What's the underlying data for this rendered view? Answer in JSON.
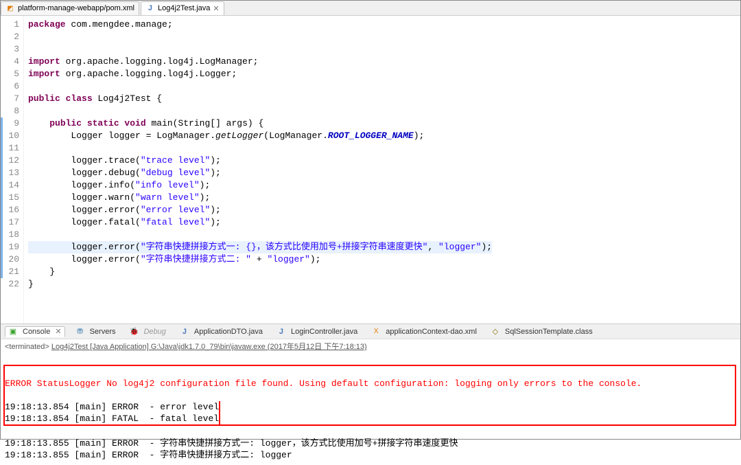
{
  "topTabs": {
    "inactive": "platform-manage-webapp/pom.xml",
    "active": "Log4j2Test.java"
  },
  "gutterLines": [
    "1",
    "2",
    "3",
    "4",
    "5",
    "6",
    "7",
    "8",
    "9",
    "10",
    "11",
    "12",
    "13",
    "14",
    "15",
    "16",
    "17",
    "18",
    "19",
    "20",
    "21",
    "22"
  ],
  "modifiedLines": [
    9,
    10,
    11,
    12,
    13,
    14,
    15,
    16,
    17,
    18,
    19,
    20,
    21
  ],
  "highlightedLine": 19,
  "code": {
    "l1": {
      "tokens": [
        {
          "t": "package ",
          "c": "kw"
        },
        {
          "t": "com.mengdee.manage;",
          "c": ""
        }
      ]
    },
    "l2": {
      "tokens": []
    },
    "l3": {
      "tokens": []
    },
    "l4": {
      "tokens": [
        {
          "t": "import ",
          "c": "kw"
        },
        {
          "t": "org.apache.logging.log4j.LogManager;",
          "c": ""
        }
      ]
    },
    "l5": {
      "tokens": [
        {
          "t": "import ",
          "c": "kw"
        },
        {
          "t": "org.apache.logging.log4j.Logger;",
          "c": ""
        }
      ]
    },
    "l6": {
      "tokens": []
    },
    "l7": {
      "tokens": [
        {
          "t": "public class ",
          "c": "kw"
        },
        {
          "t": "Log4j2Test {",
          "c": ""
        }
      ]
    },
    "l8": {
      "tokens": []
    },
    "l9": {
      "tokens": [
        {
          "t": "    ",
          "c": ""
        },
        {
          "t": "public static void ",
          "c": "kw"
        },
        {
          "t": "main(String[] args) {",
          "c": ""
        }
      ]
    },
    "l10": {
      "tokens": [
        {
          "t": "        Logger logger = LogManager.",
          "c": ""
        },
        {
          "t": "getLogger",
          "c": "it"
        },
        {
          "t": "(LogManager.",
          "c": ""
        },
        {
          "t": "ROOT_LOGGER_NAME",
          "c": "str it kw",
          "style": "color:#0000c0;font-style:italic;font-weight:bold"
        },
        {
          "t": ");",
          "c": ""
        }
      ]
    },
    "l11": {
      "tokens": []
    },
    "l12": {
      "tokens": [
        {
          "t": "        logger.trace(",
          "c": ""
        },
        {
          "t": "\"trace level\"",
          "c": "str"
        },
        {
          "t": ");",
          "c": ""
        }
      ]
    },
    "l13": {
      "tokens": [
        {
          "t": "        logger.debug(",
          "c": ""
        },
        {
          "t": "\"debug level\"",
          "c": "str"
        },
        {
          "t": ");",
          "c": ""
        }
      ]
    },
    "l14": {
      "tokens": [
        {
          "t": "        logger.info(",
          "c": ""
        },
        {
          "t": "\"info level\"",
          "c": "str"
        },
        {
          "t": ");",
          "c": ""
        }
      ]
    },
    "l15": {
      "tokens": [
        {
          "t": "        logger.warn(",
          "c": ""
        },
        {
          "t": "\"warn level\"",
          "c": "str"
        },
        {
          "t": ");",
          "c": ""
        }
      ]
    },
    "l16": {
      "tokens": [
        {
          "t": "        logger.error(",
          "c": ""
        },
        {
          "t": "\"error level\"",
          "c": "str"
        },
        {
          "t": ");",
          "c": ""
        }
      ]
    },
    "l17": {
      "tokens": [
        {
          "t": "        logger.fatal(",
          "c": ""
        },
        {
          "t": "\"fatal level\"",
          "c": "str"
        },
        {
          "t": ");",
          "c": ""
        }
      ]
    },
    "l18": {
      "tokens": []
    },
    "l19": {
      "tokens": [
        {
          "t": "        logger.error(",
          "c": ""
        },
        {
          "t": "\"字符串快捷拼接方式一: {}，该方式比使用加号+拼接字符串速度更快\"",
          "c": "str"
        },
        {
          "t": ", ",
          "c": ""
        },
        {
          "t": "\"logger\"",
          "c": "str"
        },
        {
          "t": ");",
          "c": ""
        }
      ]
    },
    "l20": {
      "tokens": [
        {
          "t": "        logger.error(",
          "c": ""
        },
        {
          "t": "\"字符串快捷拼接方式二: \"",
          "c": "str"
        },
        {
          "t": " + ",
          "c": ""
        },
        {
          "t": "\"logger\"",
          "c": "str"
        },
        {
          "t": ");",
          "c": ""
        }
      ]
    },
    "l21": {
      "tokens": [
        {
          "t": "    }",
          "c": ""
        }
      ]
    },
    "l22": {
      "tokens": [
        {
          "t": "}",
          "c": ""
        }
      ]
    }
  },
  "bottomTabs": {
    "console": "Console",
    "servers": "Servers",
    "debug": "Debug",
    "dto": "ApplicationDTO.java",
    "login": "LoginController.java",
    "appctx": "applicationContext-dao.xml",
    "ssess": "SqlSessionTemplate.class"
  },
  "consoleMeta": {
    "prefix": "<terminated> ",
    "link": "Log4j2Test [Java Application] G:\\Java\\jdk1.7.0_79\\bin\\javaw.exe (2017年5月12日 下午7:18:13)"
  },
  "console": {
    "errLine": "ERROR StatusLogger No log4j2 configuration file found. Using default configuration: logging only errors to the console.",
    "l2": "19:18:13.854 [main] ERROR  - error level",
    "l3": "19:18:13.854 [main] FATAL  - fatal level",
    "l4": "19:18:13.855 [main] ERROR  - 字符串快捷拼接方式一: logger，该方式比使用加号+拼接字符串速度更快",
    "l5": "19:18:13.855 [main] ERROR  - 字符串快捷拼接方式二: logger"
  }
}
